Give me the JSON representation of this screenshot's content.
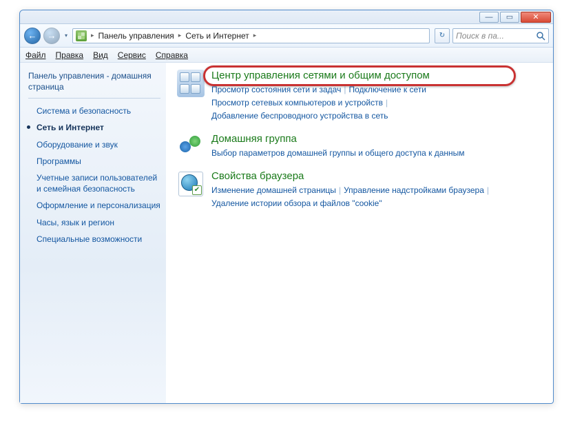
{
  "titlebar": {
    "min": "—",
    "max": "▭",
    "close": "✕"
  },
  "nav": {
    "back": "←",
    "fwd": "→",
    "refresh": "↻",
    "drop": "▾"
  },
  "breadcrumb": {
    "sep": "▸",
    "item1": "Панель управления",
    "item2": "Сеть и Интернет"
  },
  "search": {
    "placeholder": "Поиск в па..."
  },
  "menu": {
    "file": "Файл",
    "edit": "Правка",
    "view": "Вид",
    "service": "Сервис",
    "help": "Справка"
  },
  "sidebar": {
    "header": "Панель управления - домашняя страница",
    "items": [
      "Система и безопасность",
      "Сеть и Интернет",
      "Оборудование и звук",
      "Программы",
      "Учетные записи пользователей и семейная безопасность",
      "Оформление и персонализация",
      "Часы, язык и регион",
      "Специальные возможности"
    ]
  },
  "categories": [
    {
      "title": "Центр управления сетями и общим доступом",
      "links": [
        "Просмотр состояния сети и задач",
        "Подключение к сети",
        "Просмотр сетевых компьютеров и устройств",
        "Добавление беспроводного устройства в сеть"
      ]
    },
    {
      "title": "Домашняя группа",
      "links": [
        "Выбор параметров домашней группы и общего доступа к данным"
      ]
    },
    {
      "title": "Свойства браузера",
      "links": [
        "Изменение домашней страницы",
        "Управление надстройками браузера",
        "Удаление истории обзора и файлов \"cookie\""
      ]
    }
  ]
}
